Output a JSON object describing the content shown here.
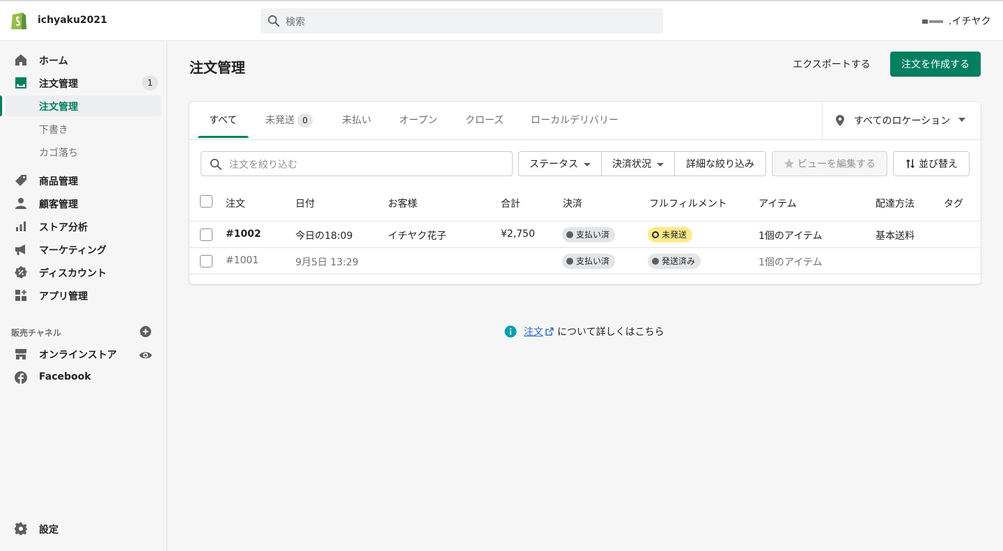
{
  "topbar": {
    "shop_name": "ichyaku2021",
    "search_placeholder": "検索",
    "store_name": ".イチヤク"
  },
  "sidebar": {
    "home": "ホーム",
    "orders": "注文管理",
    "orders_badge": "1",
    "orders_sub": [
      "注文管理",
      "下書き",
      "カゴ落ち"
    ],
    "products": "商品管理",
    "customers": "顧客管理",
    "analytics": "ストア分析",
    "marketing": "マーケティング",
    "discounts": "ディスカウント",
    "apps": "アプリ管理",
    "sales_channels_label": "販売チャネル",
    "online_store": "オンラインストア",
    "facebook": "Facebook",
    "settings": "設定"
  },
  "page": {
    "title": "注文管理",
    "export_label": "エクスポートする",
    "create_label": "注文を作成する"
  },
  "tabs": [
    {
      "label": "すべて"
    },
    {
      "label": "未発送",
      "badge": "0"
    },
    {
      "label": "未払い"
    },
    {
      "label": "オープン"
    },
    {
      "label": "クローズ"
    },
    {
      "label": "ローカルデリバリー"
    }
  ],
  "location_filter": "すべてのロケーション",
  "filters": {
    "search_placeholder": "注文を絞り込む",
    "status": "ステータス",
    "payment_status": "決済状況",
    "more_filters": "詳細な絞り込み",
    "edit_view": "ビューを編集する",
    "sort": "並び替え"
  },
  "table": {
    "headers": [
      "注文",
      "日付",
      "お客様",
      "合計",
      "決済",
      "フルフィルメント",
      "アイテム",
      "配達方法",
      "タグ"
    ],
    "rows": [
      {
        "order": "#1002",
        "date": "今日の18:09",
        "customer": "イチヤク花子",
        "total": "¥2,750",
        "payment": "支払い済",
        "fulfillment": "未発送",
        "items": "1個のアイテム",
        "delivery": "基本送料",
        "tags": ""
      },
      {
        "order": "#1001",
        "date": "9月5日 13:29",
        "customer": "",
        "total": "",
        "payment": "支払い済",
        "fulfillment": "発送済み",
        "items": "1個のアイテム",
        "delivery": "",
        "tags": ""
      }
    ]
  },
  "help": {
    "link": "注文",
    "text": "について詳しくはこちら"
  },
  "colors": {
    "primary": "#008060",
    "link": "#2c6ecb",
    "attention": "#ffea8a"
  }
}
